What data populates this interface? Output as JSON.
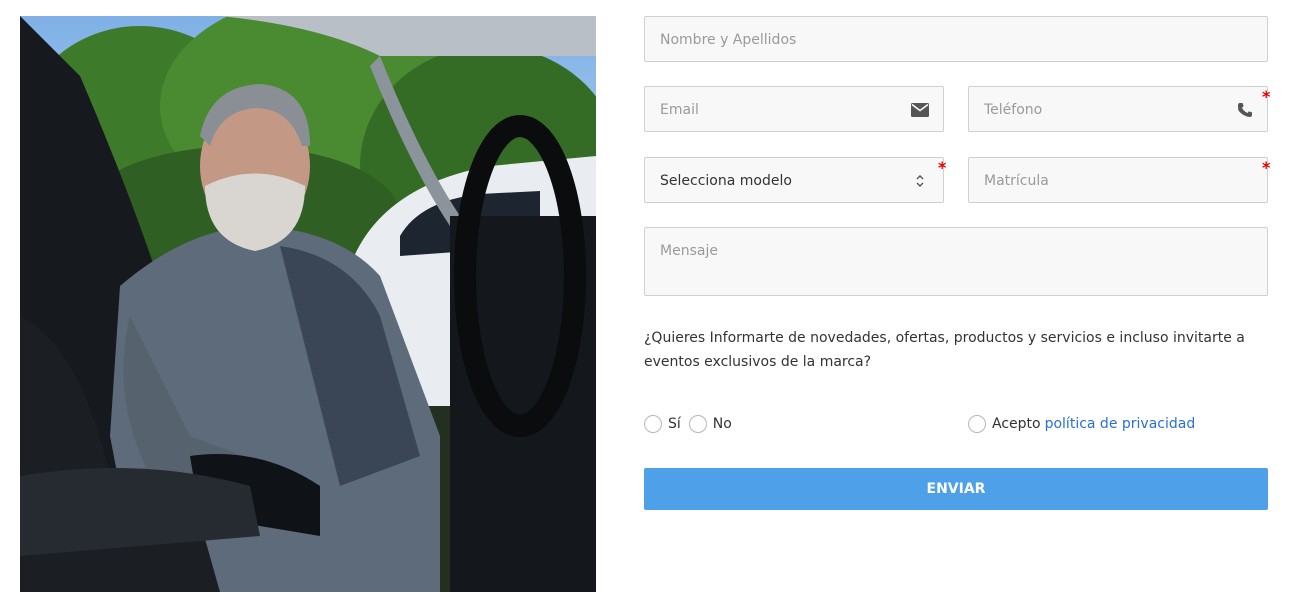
{
  "form": {
    "name_placeholder": "Nombre y Apellidos",
    "email_placeholder": "Email",
    "phone_placeholder": "Teléfono",
    "model_value": "Selecciona modelo",
    "plate_placeholder": "Matrícula",
    "message_placeholder": "Mensaje",
    "required_mark": "*",
    "question": "¿Quieres Informarte de novedades, ofertas, productos y servicios e incluso invitarte a eventos exclusivos de la marca?",
    "option_yes": "Sí",
    "option_no": "No",
    "accept_label": "Acepto",
    "privacy_link": "política de privacidad",
    "submit_label": "ENVIAR"
  },
  "icons": {
    "email": "envelope-icon",
    "phone": "phone-icon",
    "select": "chevron-up-down-icon"
  },
  "colors": {
    "required": "#e60000",
    "link": "#2a6fd6",
    "submit": "#4ea1e8",
    "field_bg": "#f8f8f8"
  }
}
